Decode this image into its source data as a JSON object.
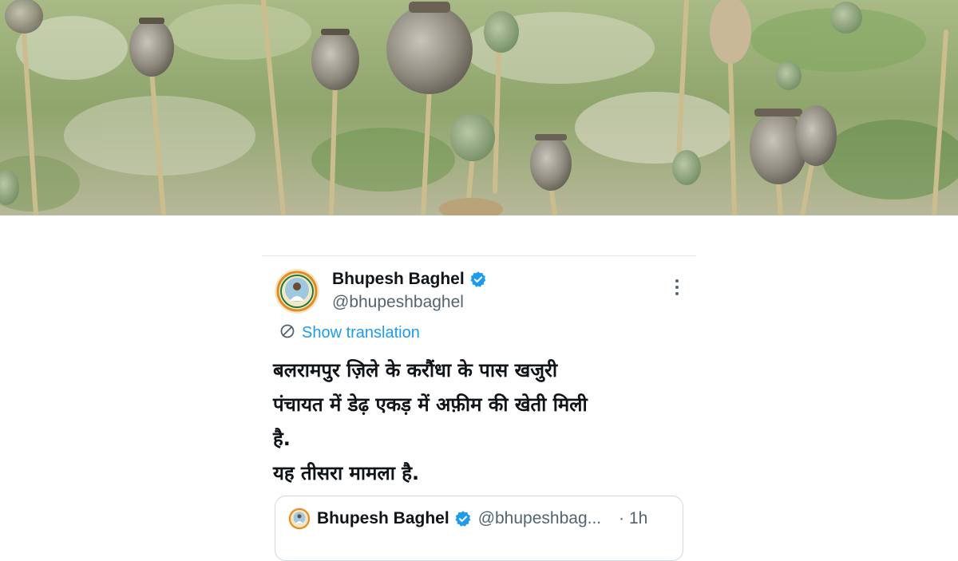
{
  "hero": {
    "image": "poppy-field-photo"
  },
  "tweet": {
    "author": {
      "name": "Bhupesh Baghel",
      "handle": "@bhupeshbaghel",
      "verified": true,
      "verified_color": "#1d9bf0",
      "avatar_icon": "profile-avatar"
    },
    "more_icon": "more-vertical-icon",
    "translation": {
      "icon": "globe-translate-icon",
      "label": "Show translation"
    },
    "text_lines": [
      "बलरामपुर ज़िले के करौंधा के पास खजुरी",
      "पंचायत में डेढ़ एकड़ में अफ़ीम की खेती मिली",
      "है.",
      "यह तीसरा मामला है."
    ]
  },
  "quoted_tweet": {
    "name": "Bhupesh Baghel",
    "handle": "@bhupeshbag...",
    "time": "· 1h"
  },
  "colors": {
    "accent": "#1d9bf0",
    "text": "#0f1419",
    "muted": "#536471"
  }
}
